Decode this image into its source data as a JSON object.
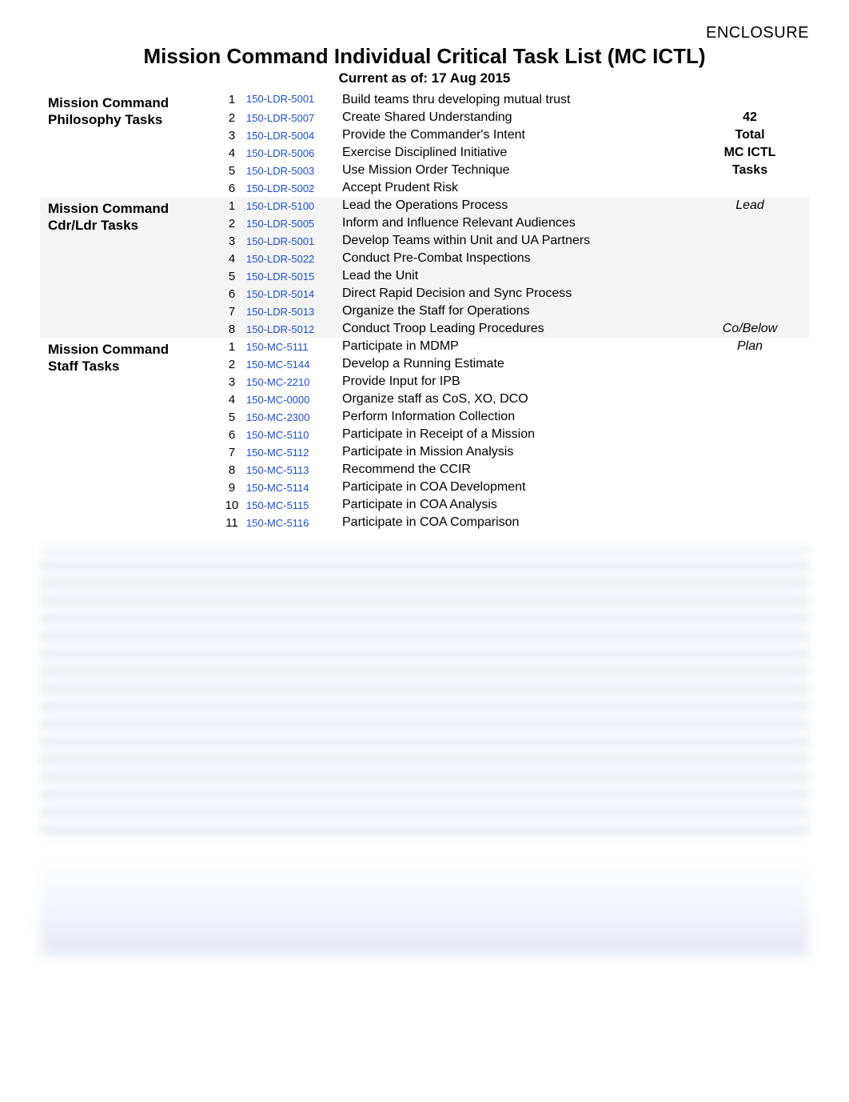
{
  "header": {
    "enclosure": "ENCLOSURE",
    "title": "Mission Command Individual Critical Task List (MC ICTL)",
    "subtitle": "Current as of: 17 Aug 2015"
  },
  "summary": {
    "count": "42",
    "total_label": "Total",
    "mcictl_label": "MC ICTL",
    "tasks_label": "Tasks"
  },
  "sections": [
    {
      "label_line1": "Mission Command",
      "label_line2": "Philosophy Tasks",
      "shade": false,
      "right_notes": [
        "",
        "42",
        "Total",
        "MC ICTL",
        "Tasks",
        ""
      ],
      "rows": [
        {
          "n": "1",
          "code": "150-LDR-5001",
          "desc": "Build teams thru developing mutual trust"
        },
        {
          "n": "2",
          "code": "150-LDR-5007",
          "desc": "Create Shared Understanding"
        },
        {
          "n": "3",
          "code": "150-LDR-5004",
          "desc": "Provide the Commander's Intent"
        },
        {
          "n": "4",
          "code": "150-LDR-5006",
          "desc": "Exercise Disciplined Initiative"
        },
        {
          "n": "5",
          "code": "150-LDR-5003",
          "desc": "Use Mission Order Technique"
        },
        {
          "n": "6",
          "code": "150-LDR-5002",
          "desc": "Accept Prudent Risk"
        }
      ]
    },
    {
      "label_line1": "Mission Command",
      "label_line2": "Cdr/Ldr Tasks",
      "shade": true,
      "right_notes": [
        "Lead",
        "",
        "",
        "",
        "",
        "",
        "",
        "Co/Below"
      ],
      "rows": [
        {
          "n": "1",
          "code": "150-LDR-5100",
          "desc": "Lead the Operations Process"
        },
        {
          "n": "2",
          "code": "150-LDR-5005",
          "desc": "Inform and Influence Relevant Audiences"
        },
        {
          "n": "3",
          "code": "150-LDR-5001",
          "desc": "Develop Teams within Unit and UA Partners"
        },
        {
          "n": "4",
          "code": "150-LDR-5022",
          "desc": "Conduct Pre-Combat Inspections"
        },
        {
          "n": "5",
          "code": "150-LDR-5015",
          "desc": "Lead the Unit"
        },
        {
          "n": "6",
          "code": "150-LDR-5014",
          "desc": "Direct Rapid Decision and Sync Process"
        },
        {
          "n": "7",
          "code": "150-LDR-5013",
          "desc": "Organize the Staff for Operations"
        },
        {
          "n": "8",
          "code": "150-LDR-5012",
          "desc": "Conduct Troop Leading Procedures"
        }
      ]
    },
    {
      "label_line1": "Mission Command",
      "label_line2": "Staff Tasks",
      "shade": false,
      "right_notes": [
        "Plan",
        "",
        "",
        "",
        "",
        "",
        "",
        "",
        "",
        "",
        ""
      ],
      "rows": [
        {
          "n": "1",
          "code": "150-MC-5111",
          "desc": "Participate in  MDMP"
        },
        {
          "n": "2",
          "code": "150-MC-5144",
          "desc": "Develop a Running Estimate"
        },
        {
          "n": "3",
          "code": "150-MC-2210",
          "desc": "Provide Input for IPB"
        },
        {
          "n": "4",
          "code": "150-MC-0000",
          "desc": "Organize staff as CoS, XO, DCO"
        },
        {
          "n": "5",
          "code": "150-MC-2300",
          "desc": "Perform Information Collection"
        },
        {
          "n": "6",
          "code": "150-MC-5110",
          "desc": "Participate in Receipt of a Mission"
        },
        {
          "n": "7",
          "code": "150-MC-5112",
          "desc": "Participate in Mission Analysis"
        },
        {
          "n": "8",
          "code": "150-MC-5113",
          "desc": "Recommend the CCIR"
        },
        {
          "n": "9",
          "code": "150-MC-5114",
          "desc": "Participate in COA Development"
        },
        {
          "n": "10",
          "code": "150-MC-5115",
          "desc": "Participate in COA Analysis"
        },
        {
          "n": "11",
          "code": "150-MC-5116",
          "desc": "Participate in COA Comparison"
        }
      ]
    }
  ]
}
